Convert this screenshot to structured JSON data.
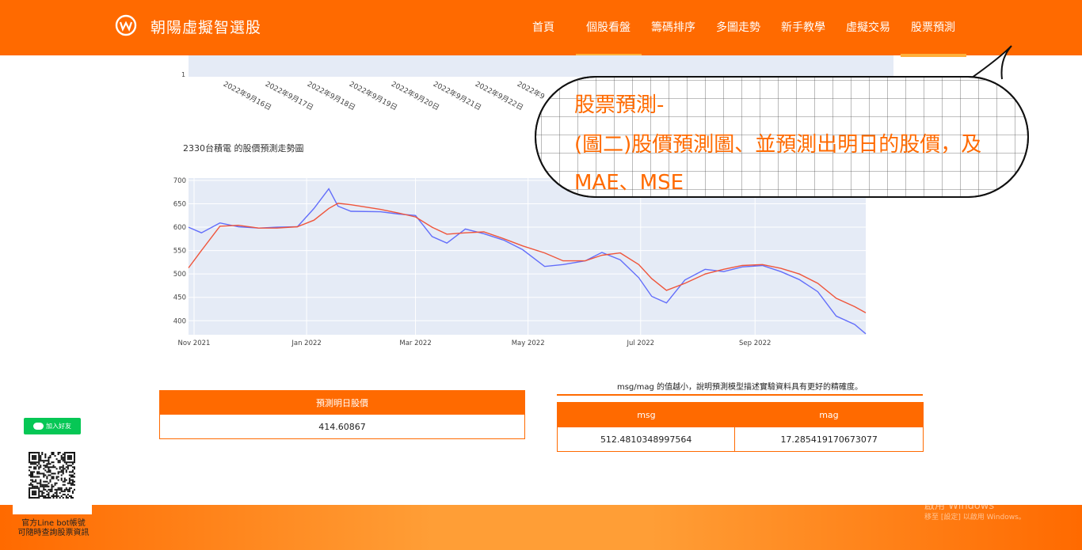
{
  "header": {
    "brand": "朝陽虛擬智選股",
    "nav": [
      "首頁",
      "個股看盤",
      "籌碼排序",
      "多圖走勢",
      "新手教學",
      "虛擬交易",
      "股票預測"
    ]
  },
  "top_chart": {
    "y_tick": "1",
    "x_ticks": [
      "2022年9月16日",
      "2022年9月17日",
      "2022年9月18日",
      "2022年9月19日",
      "2022年9月20日",
      "2022年9月21日",
      "2022年9月22日",
      "2022年9"
    ]
  },
  "annotation": {
    "line1": "股票預測-",
    "line2": "(圖二)股價預測圖、並預測出明日的股價，及",
    "line3": "MAE、MSE"
  },
  "chart_data": {
    "type": "line",
    "title": "2330台積電 的股價預測走勢圖",
    "x_ticks": [
      "Nov 2021",
      "Jan 2022",
      "Mar 2022",
      "May 2022",
      "Jul 2022",
      "Sep 2022"
    ],
    "y_ticks": [
      700,
      650,
      600,
      550,
      500,
      450,
      400
    ],
    "ylim": [
      370,
      705
    ],
    "colors": {
      "actual": "#636efa",
      "predicted": "#ef553b"
    },
    "series": [
      {
        "name": "",
        "x": [
          "2021-10-29",
          "2021-11-05",
          "2021-11-15",
          "2021-11-25",
          "2021-12-06",
          "2021-12-16",
          "2021-12-27",
          "2022-01-05",
          "2022-01-13",
          "2022-01-18",
          "2022-01-25",
          "2022-02-10",
          "2022-02-20",
          "2022-03-01",
          "2022-03-10",
          "2022-03-18",
          "2022-03-28",
          "2022-04-07",
          "2022-04-18",
          "2022-04-28",
          "2022-05-10",
          "2022-05-20",
          "2022-06-01",
          "2022-06-10",
          "2022-06-20",
          "2022-06-30",
          "2022-07-07",
          "2022-07-15",
          "2022-07-25",
          "2022-08-05",
          "2022-08-15",
          "2022-08-25",
          "2022-09-05",
          "2022-09-15",
          "2022-09-25",
          "2022-10-05",
          "2022-10-15",
          "2022-10-25",
          "2022-10-31"
        ],
        "values": [
          600,
          588,
          609,
          601,
          598,
          600,
          601,
          640,
          682,
          645,
          634,
          633,
          628,
          625,
          580,
          566,
          596,
          586,
          572,
          552,
          516,
          520,
          528,
          546,
          530,
          492,
          452,
          438,
          487,
          510,
          505,
          515,
          518,
          505,
          488,
          462,
          410,
          392,
          372
        ]
      },
      {
        "name": "",
        "x": [
          "2021-10-29",
          "2021-11-05",
          "2021-11-15",
          "2021-11-25",
          "2021-12-06",
          "2021-12-16",
          "2021-12-27",
          "2022-01-05",
          "2022-01-13",
          "2022-01-18",
          "2022-01-25",
          "2022-02-10",
          "2022-02-20",
          "2022-03-01",
          "2022-03-10",
          "2022-03-18",
          "2022-03-28",
          "2022-04-07",
          "2022-04-18",
          "2022-04-28",
          "2022-05-10",
          "2022-05-20",
          "2022-06-01",
          "2022-06-10",
          "2022-06-20",
          "2022-06-30",
          "2022-07-07",
          "2022-07-15",
          "2022-07-25",
          "2022-08-05",
          "2022-08-15",
          "2022-08-25",
          "2022-09-05",
          "2022-09-15",
          "2022-09-25",
          "2022-10-05",
          "2022-10-15",
          "2022-10-25",
          "2022-10-31"
        ],
        "values": [
          513,
          550,
          602,
          604,
          598,
          598,
          601,
          615,
          640,
          651,
          648,
          638,
          630,
          622,
          600,
          585,
          588,
          590,
          575,
          560,
          545,
          528,
          528,
          540,
          545,
          520,
          490,
          465,
          480,
          500,
          510,
          518,
          520,
          512,
          500,
          480,
          448,
          430,
          417
        ]
      }
    ]
  },
  "prediction_table": {
    "header": "預測明日股價",
    "value": "414.60867"
  },
  "metric_note": "msg/mag 的值越小，說明預測模型描述實驗資料具有更好的精確度。",
  "metric_table": {
    "headers": [
      "msg",
      "mag"
    ],
    "values": [
      "512.4810348997564",
      "17.285419170673077"
    ]
  },
  "sidebar": {
    "line_button": "加入好友",
    "caption_line1": "官方Line bot帳號",
    "caption_line2": "可隨時查詢股票資訊"
  },
  "watermark": {
    "line1": "啟用 Windows",
    "line2": "移至 [設定] 以啟用 Windows。"
  }
}
